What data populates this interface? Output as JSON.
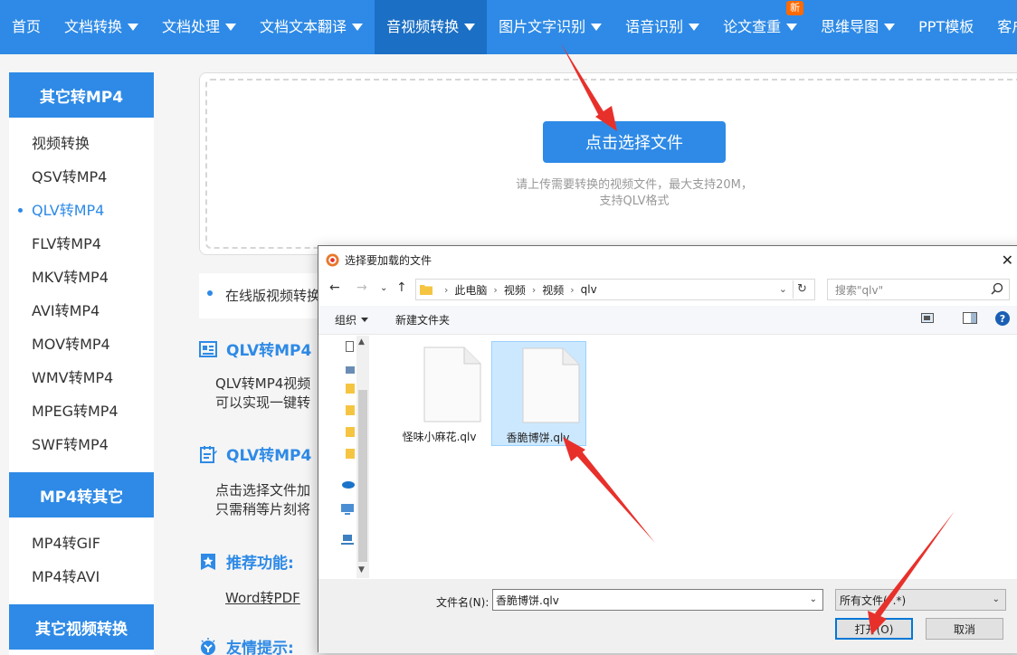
{
  "nav": {
    "items": [
      {
        "label": "首页",
        "dropdown": false
      },
      {
        "label": "文档转换",
        "dropdown": true
      },
      {
        "label": "文档处理",
        "dropdown": true
      },
      {
        "label": "文档文本翻译",
        "dropdown": true
      },
      {
        "label": "音视频转换",
        "dropdown": true,
        "active": true
      },
      {
        "label": "图片文字识别",
        "dropdown": true
      },
      {
        "label": "语音识别",
        "dropdown": true
      },
      {
        "label": "论文查重",
        "dropdown": true,
        "badge": "新"
      },
      {
        "label": "思维导图",
        "dropdown": true
      },
      {
        "label": "PPT模板",
        "dropdown": false
      },
      {
        "label": "客户端",
        "dropdown": false
      }
    ]
  },
  "sidebar": {
    "sections": [
      {
        "title": "其它转MP4",
        "items": [
          "视频转换",
          "QSV转MP4",
          "QLV转MP4",
          "FLV转MP4",
          "MKV转MP4",
          "AVI转MP4",
          "MOV转MP4",
          "WMV转MP4",
          "MPEG转MP4",
          "SWF转MP4"
        ],
        "active": 2
      },
      {
        "title": "MP4转其它",
        "items": [
          "MP4转GIF",
          "MP4转AVI"
        ],
        "active": -1
      },
      {
        "title": "其它视频转换",
        "items": [],
        "active": -1
      }
    ]
  },
  "upload": {
    "button": "点击选择文件",
    "hint_line1": "请上传需要转换的视频文件，最大支持20M，",
    "hint_line2": "支持QLV格式"
  },
  "content": {
    "online_text": "在线版视频转换",
    "sec1_title": "QLV转MP4",
    "sec1_line1": "QLV转MP4视频",
    "sec1_line2": "可以实现一键转",
    "sec2_title": "QLV转MP4",
    "sec2_line1": "点击选择文件加",
    "sec2_line2": "只需稍等片刻将",
    "rec_title": "推荐功能:",
    "rec_link": "Word转PDF",
    "tip_title": "友情提示:"
  },
  "dialog": {
    "title": "选择要加载的文件",
    "breadcrumb": [
      "此电脑",
      "视频",
      "视频",
      "qlv"
    ],
    "search_placeholder": "搜索\"qlv\"",
    "toolbar_organize": "组织",
    "toolbar_new_folder": "新建文件夹",
    "files": [
      {
        "name": "怪味小麻花.qlv",
        "selected": false
      },
      {
        "name": "香脆博饼.qlv",
        "selected": true
      }
    ],
    "filename_label": "文件名(N):",
    "filename_value": "香脆博饼.qlv",
    "filetype_value": "所有文件(*.*)",
    "open_label": "打开(O)",
    "cancel_label": "取消"
  },
  "colors": {
    "brand": "#2e8ae6",
    "nav_active": "#1b6fc4",
    "badge": "#ff6a00",
    "arrow": "#e8302b",
    "selection": "#cce8ff"
  }
}
